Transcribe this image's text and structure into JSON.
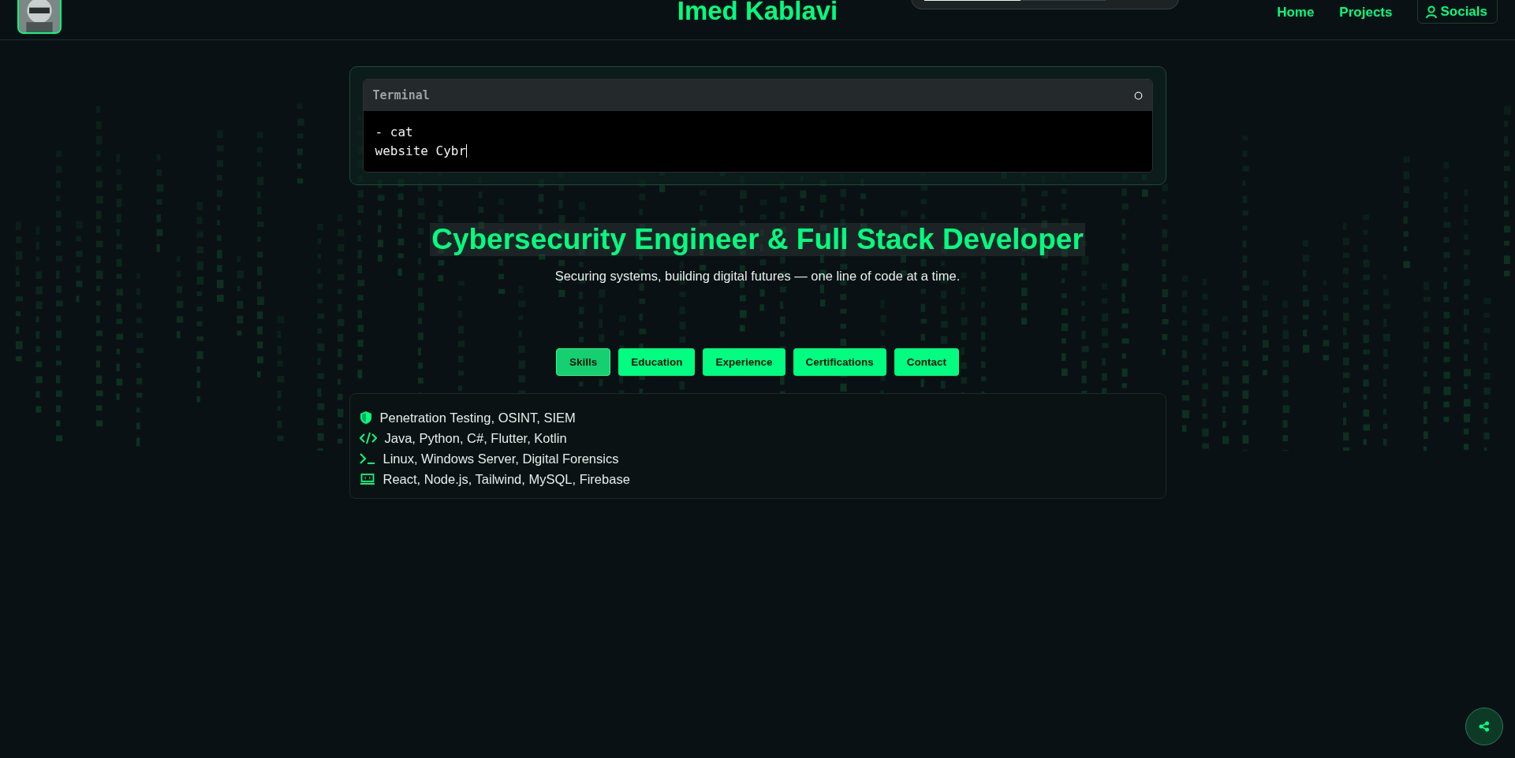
{
  "header": {
    "title": "Imed Kablavi",
    "scroll_progress": {
      "level": 0.53
    },
    "nav": [
      {
        "label": "Home",
        "kind": "link"
      },
      {
        "label": "Projects",
        "kind": "link"
      },
      {
        "label": "Socials",
        "kind": "button"
      }
    ]
  },
  "terminal": {
    "title": "Terminal",
    "lines": [
      "- cat",
      "website Cybr"
    ]
  },
  "hero": {
    "heading": "Cybersecurity Engineer & Full Stack Developer",
    "tagline": "Securing systems, building digital futures — one line of code at a time."
  },
  "tabs": [
    {
      "label": "Skills",
      "selected": true
    },
    {
      "label": "Education",
      "selected": false
    },
    {
      "label": "Experience",
      "selected": false
    },
    {
      "label": "Certifications",
      "selected": false
    },
    {
      "label": "Contact",
      "selected": false
    }
  ],
  "skills": [
    {
      "kind": "shield",
      "text": "Penetration Testing, OSINT, SIEM"
    },
    {
      "kind": "code",
      "text": "Java, Python, C#, Flutter, Kotlin"
    },
    {
      "kind": "terminal",
      "text": "Linux, Windows Server, Digital Forensics"
    },
    {
      "kind": "laptop",
      "text": "React, Node.js, Tailwind, MySQL, Firebase"
    }
  ]
}
